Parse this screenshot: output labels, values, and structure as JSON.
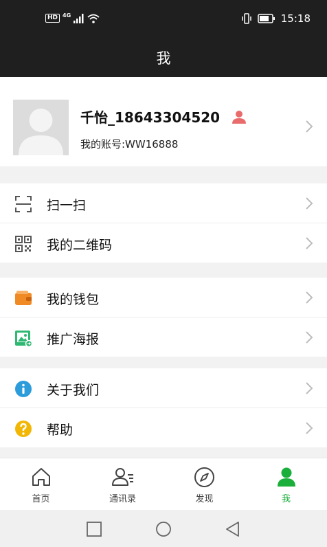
{
  "status_bar": {
    "network": "4G",
    "hd": "HD",
    "time": "15:18"
  },
  "header": {
    "title": "我"
  },
  "profile": {
    "name": "千怡_18643304520",
    "account": "我的账号:WW16888"
  },
  "menu_groups": [
    {
      "items": [
        {
          "label": "扫一扫",
          "icon": "scan-icon"
        },
        {
          "label": "我的二维码",
          "icon": "qr-code-icon"
        }
      ]
    },
    {
      "items": [
        {
          "label": "我的钱包",
          "icon": "wallet-icon"
        },
        {
          "label": "推广海报",
          "icon": "poster-icon"
        }
      ]
    },
    {
      "items": [
        {
          "label": "关于我们",
          "icon": "info-icon"
        },
        {
          "label": "帮助",
          "icon": "help-icon"
        }
      ]
    }
  ],
  "tab_bar": {
    "tabs": [
      {
        "label": "首页",
        "icon": "home-icon"
      },
      {
        "label": "通讯录",
        "icon": "contacts-icon"
      },
      {
        "label": "发现",
        "icon": "compass-icon"
      },
      {
        "label": "我",
        "icon": "user-icon"
      }
    ],
    "active": 3
  },
  "colors": {
    "accent": "#1aaf3a",
    "header_bg": "#1f1f1f",
    "wallet": "#f08a24",
    "poster": "#2eb872",
    "info": "#2d9cdb",
    "help": "#f2b705"
  }
}
